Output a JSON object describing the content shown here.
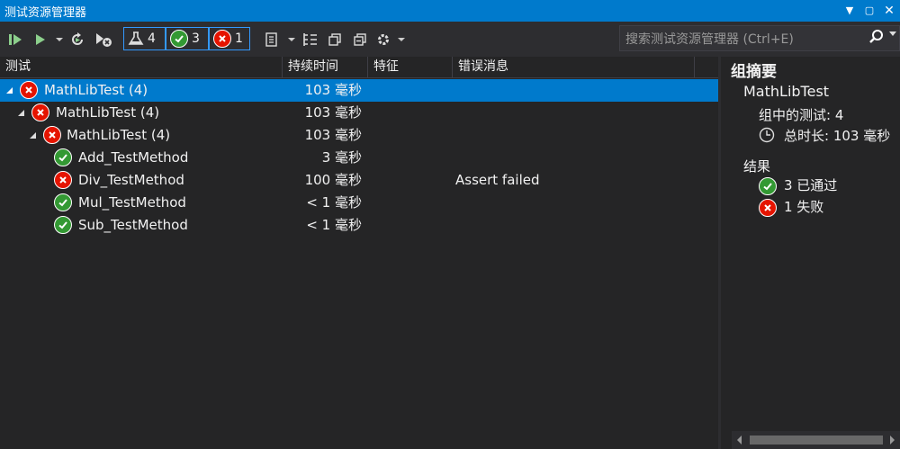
{
  "window": {
    "title": "测试资源管理器"
  },
  "toolbar": {
    "badges": [
      {
        "kind": "flask-icon",
        "count": "4"
      },
      {
        "kind": "passed-icon",
        "count": "3"
      },
      {
        "kind": "failed-icon",
        "count": "1"
      }
    ]
  },
  "search": {
    "placeholder": "搜索测试资源管理器 (Ctrl+E)"
  },
  "columns": {
    "test": "测试",
    "duration": "持续时间",
    "traits": "特征",
    "error": "错误消息"
  },
  "rows": [
    {
      "name": "MathLibTest (4)",
      "status": "failed",
      "duration": "103 毫秒",
      "error": ""
    },
    {
      "name": "MathLibTest (4)",
      "status": "failed",
      "duration": "103 毫秒",
      "error": ""
    },
    {
      "name": "MathLibTest (4)",
      "status": "failed",
      "duration": "103 毫秒",
      "error": ""
    },
    {
      "name": "Add_TestMethod",
      "status": "passed",
      "duration": "3 毫秒",
      "error": ""
    },
    {
      "name": "Div_TestMethod",
      "status": "failed",
      "duration": "100 毫秒",
      "error": "Assert failed"
    },
    {
      "name": "Mul_TestMethod",
      "status": "passed",
      "duration": "< 1 毫秒",
      "error": ""
    },
    {
      "name": "Sub_TestMethod",
      "status": "passed",
      "duration": "< 1 毫秒",
      "error": ""
    }
  ],
  "summary": {
    "heading": "组摘要",
    "group_name": "MathLibTest",
    "tests_in_group": "组中的测试: 4",
    "total_duration": "总时长: 103 毫秒",
    "results_heading": "结果",
    "passed": "3 已通过",
    "failed": "1 失败"
  },
  "colors": {
    "accent": "#007acc",
    "pass": "#339933",
    "fail": "#e51400"
  }
}
